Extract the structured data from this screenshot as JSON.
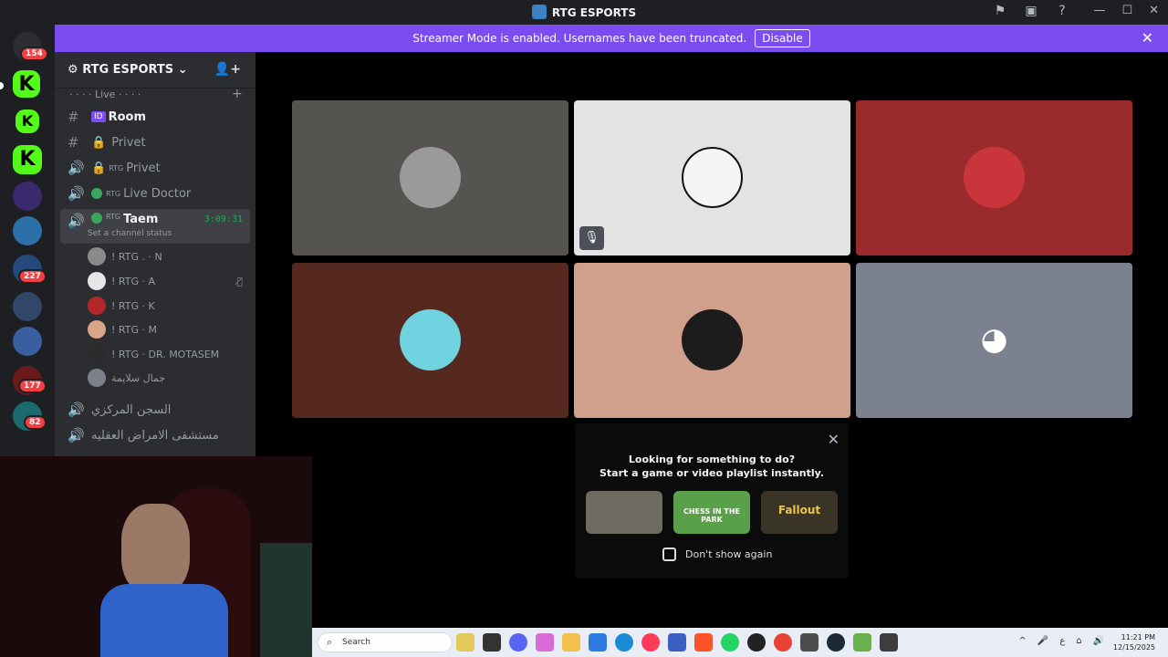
{
  "window": {
    "title": "RTG ESPORTS"
  },
  "banner": {
    "text": "Streamer Mode is enabled. Usernames have been truncated.",
    "disable_label": "Disable"
  },
  "servers": {
    "badges": [
      "154",
      "227",
      "177",
      "82"
    ]
  },
  "guild": {
    "name": "RTG ESPORTS"
  },
  "category": {
    "name": "· · · · Live · · · ·"
  },
  "channels": [
    {
      "name": "Room"
    },
    {
      "name": "Privet"
    },
    {
      "prefix": "RTG",
      "name": "Privet"
    },
    {
      "prefix": "RTG",
      "name": "Live Doctor"
    },
    {
      "prefix": "RTG",
      "name": "Taem",
      "timer": "3:09:31",
      "status": "Set a channel status"
    }
  ],
  "voice_users": [
    {
      "name": "! RTG . · N"
    },
    {
      "name": "! RTG · A"
    },
    {
      "name": "! RTG · K"
    },
    {
      "name": "! RTG · M"
    },
    {
      "name": "! RTG · DR. MOTASEM"
    },
    {
      "name": "جمال سلايمة"
    }
  ],
  "more_channels": [
    {
      "name": "السجن المركزي"
    },
    {
      "name": "مستشفى الامراض العقليه"
    }
  ],
  "activity": {
    "line1": "Looking for something to do?",
    "line2": "Start a game or video playlist instantly.",
    "cards": [
      "",
      "CHESS IN THE PARK",
      "Fallout"
    ],
    "dont_show": "Don't show again"
  },
  "taskbar": {
    "search": "Search",
    "time": "11:21 PM",
    "date": "12/15/2025"
  }
}
